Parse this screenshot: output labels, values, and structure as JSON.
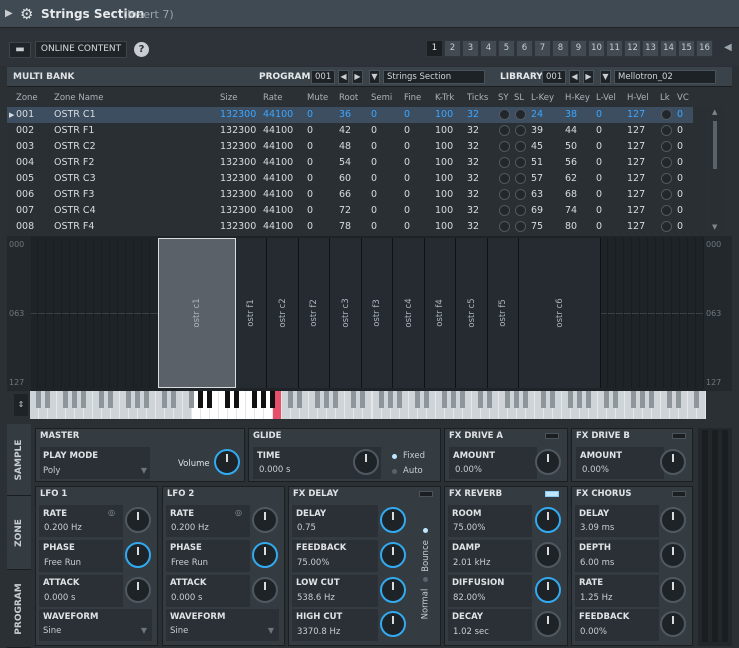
{
  "title": {
    "name": "Strings Section",
    "insert": "(Insert 7)"
  },
  "toolbar": {
    "online_content": "ONLINE CONTENT",
    "pages": [
      "1",
      "2",
      "3",
      "4",
      "5",
      "6",
      "7",
      "8",
      "9",
      "10",
      "11",
      "12",
      "13",
      "14",
      "15",
      "16"
    ],
    "active_page": "1"
  },
  "header": {
    "multi_bank": "MULTI BANK",
    "program_label": "PROGRAM",
    "program_num": "001",
    "program_name": "Strings Section",
    "library_label": "LIBRARY",
    "library_num": "001",
    "library_name": "Mellotron_02"
  },
  "columns": [
    "Zone",
    "Zone Name",
    "Size",
    "Rate",
    "Mute",
    "Root",
    "Semi",
    "Fine",
    "K-Trk",
    "Ticks",
    "SY",
    "SL",
    "L-Key",
    "H-Key",
    "L-Vel",
    "H-Vel",
    "Lk",
    "VC"
  ],
  "zones": [
    {
      "zone": "001",
      "name": "OSTR C1",
      "size": "132300",
      "rate": "44100",
      "mute": "0",
      "root": "36",
      "semi": "0",
      "fine": "0",
      "ktrk": "100",
      "ticks": "32",
      "lkey": "24",
      "hkey": "38",
      "lvel": "0",
      "hvel": "127",
      "vc": "0"
    },
    {
      "zone": "002",
      "name": "OSTR F1",
      "size": "132300",
      "rate": "44100",
      "mute": "0",
      "root": "42",
      "semi": "0",
      "fine": "0",
      "ktrk": "100",
      "ticks": "32",
      "lkey": "39",
      "hkey": "44",
      "lvel": "0",
      "hvel": "127",
      "vc": "0"
    },
    {
      "zone": "003",
      "name": "OSTR C2",
      "size": "132300",
      "rate": "44100",
      "mute": "0",
      "root": "48",
      "semi": "0",
      "fine": "0",
      "ktrk": "100",
      "ticks": "32",
      "lkey": "45",
      "hkey": "50",
      "lvel": "0",
      "hvel": "127",
      "vc": "0"
    },
    {
      "zone": "004",
      "name": "OSTR F2",
      "size": "132300",
      "rate": "44100",
      "mute": "0",
      "root": "54",
      "semi": "0",
      "fine": "0",
      "ktrk": "100",
      "ticks": "32",
      "lkey": "51",
      "hkey": "56",
      "lvel": "0",
      "hvel": "127",
      "vc": "0"
    },
    {
      "zone": "005",
      "name": "OSTR C3",
      "size": "132300",
      "rate": "44100",
      "mute": "0",
      "root": "60",
      "semi": "0",
      "fine": "0",
      "ktrk": "100",
      "ticks": "32",
      "lkey": "57",
      "hkey": "62",
      "lvel": "0",
      "hvel": "127",
      "vc": "0"
    },
    {
      "zone": "006",
      "name": "OSTR F3",
      "size": "132300",
      "rate": "44100",
      "mute": "0",
      "root": "66",
      "semi": "0",
      "fine": "0",
      "ktrk": "100",
      "ticks": "32",
      "lkey": "63",
      "hkey": "68",
      "lvel": "0",
      "hvel": "127",
      "vc": "0"
    },
    {
      "zone": "007",
      "name": "OSTR C4",
      "size": "132300",
      "rate": "44100",
      "mute": "0",
      "root": "72",
      "semi": "0",
      "fine": "0",
      "ktrk": "100",
      "ticks": "32",
      "lkey": "69",
      "hkey": "74",
      "lvel": "0",
      "hvel": "127",
      "vc": "0"
    },
    {
      "zone": "008",
      "name": "OSTR F4",
      "size": "132300",
      "rate": "44100",
      "mute": "0",
      "root": "78",
      "semi": "0",
      "fine": "0",
      "ktrk": "100",
      "ticks": "32",
      "lkey": "75",
      "hkey": "80",
      "lvel": "0",
      "hvel": "127",
      "vc": "0"
    }
  ],
  "keymap": {
    "zones": [
      "ostr c1",
      "ostr f1",
      "ostr c2",
      "ostr f2",
      "ostr c3",
      "ostr f3",
      "ostr c4",
      "ostr f4",
      "ostr c5",
      "ostr f5",
      "ostr c6"
    ],
    "vel_labels": [
      "000",
      "063",
      "127"
    ]
  },
  "tabs": [
    "SAMPLE",
    "ZONE",
    "PROGRAM"
  ],
  "master": {
    "title": "MASTER",
    "play_mode_label": "PLAY MODE",
    "play_mode": "Poly",
    "volume_label": "Volume"
  },
  "glide": {
    "title": "GLIDE",
    "time_label": "TIME",
    "time": "0.000 s",
    "fixed": "Fixed",
    "auto": "Auto"
  },
  "fx_drive_a": {
    "title": "FX DRIVE A",
    "amount_label": "AMOUNT",
    "amount": "0.00%"
  },
  "fx_drive_b": {
    "title": "FX DRIVE B",
    "amount_label": "AMOUNT",
    "amount": "0.00%"
  },
  "lfo1": {
    "title": "LFO 1",
    "rate_label": "RATE",
    "rate": "0.200 Hz",
    "phase_label": "PHASE",
    "phase": "Free Run",
    "attack_label": "ATTACK",
    "attack": "0.000 s",
    "waveform_label": "WAVEFORM",
    "waveform": "Sine"
  },
  "lfo2": {
    "title": "LFO 2",
    "rate_label": "RATE",
    "rate": "0.200 Hz",
    "phase_label": "PHASE",
    "phase": "Free Run",
    "attack_label": "ATTACK",
    "attack": "0.000 s",
    "waveform_label": "WAVEFORM",
    "waveform": "Sine"
  },
  "fx_delay": {
    "title": "FX DELAY",
    "delay_label": "DELAY",
    "delay": "0.75",
    "feedback_label": "FEEDBACK",
    "feedback": "75.00%",
    "lowcut_label": "LOW CUT",
    "lowcut": "538.6 Hz",
    "highcut_label": "HIGH CUT",
    "highcut": "3370.8 Hz",
    "bounce": "Bounce",
    "normal": "Normal"
  },
  "fx_reverb": {
    "title": "FX REVERB",
    "room_label": "ROOM",
    "room": "75.00%",
    "damp_label": "DAMP",
    "damp": "2.01 kHz",
    "diffusion_label": "DIFFUSION",
    "diffusion": "82.00%",
    "decay_label": "DECAY",
    "decay": "1.02 sec"
  },
  "fx_chorus": {
    "title": "FX CHORUS",
    "delay_label": "DELAY",
    "delay": "3.09 ms",
    "depth_label": "DEPTH",
    "depth": "6.00 ms",
    "rate_label": "RATE",
    "rate": "1.25 Hz",
    "feedback_label": "FEEDBACK",
    "feedback": "0.00%"
  },
  "colors": {
    "accent": "#33aaf0",
    "selected_row": "#3c4e60",
    "value_blue": "#3ea6ff"
  }
}
